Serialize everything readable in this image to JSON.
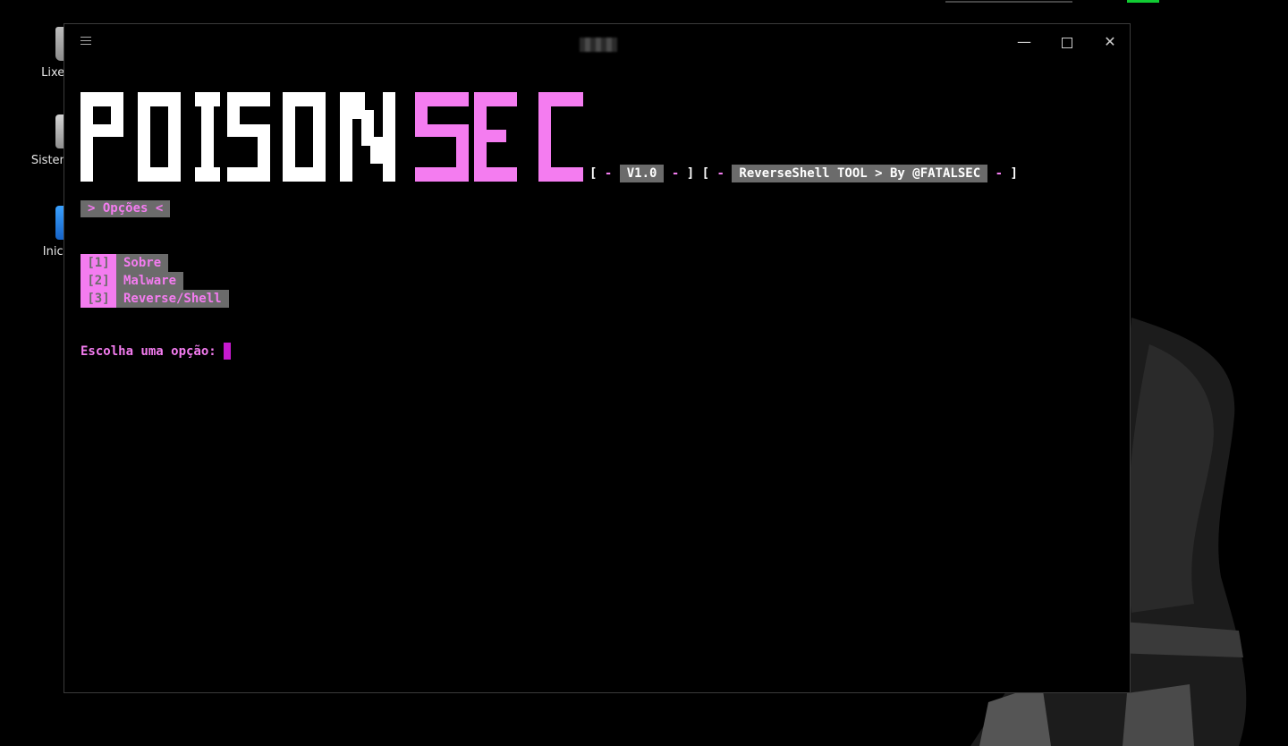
{
  "desktop": {
    "icons": [
      {
        "label": "Lixei",
        "icon": "trash-icon"
      },
      {
        "label": "Sistema",
        "icon": "drive-icon"
      },
      {
        "label": "Inici",
        "icon": "home-folder-icon"
      }
    ]
  },
  "window": {
    "menu_icon": "hamburger-icon",
    "minimize_glyph": "—",
    "close_glyph": "✕"
  },
  "terminal": {
    "logo_part1": "POISON",
    "logo_part2": "SEC",
    "logo_colors": {
      "part1": "#ffffff",
      "part2": "#f47cf0"
    },
    "bracket_open": "[",
    "bracket_close": "]",
    "dash": "-",
    "version": "V1.0",
    "tagline": "ReverseShell TOOL > By @FATALSEC",
    "options_header": "> Opções <",
    "menu": [
      {
        "num": "[1]",
        "label": "Sobre"
      },
      {
        "num": "[2]",
        "label": "Malware"
      },
      {
        "num": "[3]",
        "label": "Reverse/Shell"
      }
    ],
    "prompt": "Escolha uma opção:"
  },
  "colors": {
    "accent": "#f47cf0",
    "box": "#6b6b6b",
    "cursor": "#c71ad0"
  }
}
